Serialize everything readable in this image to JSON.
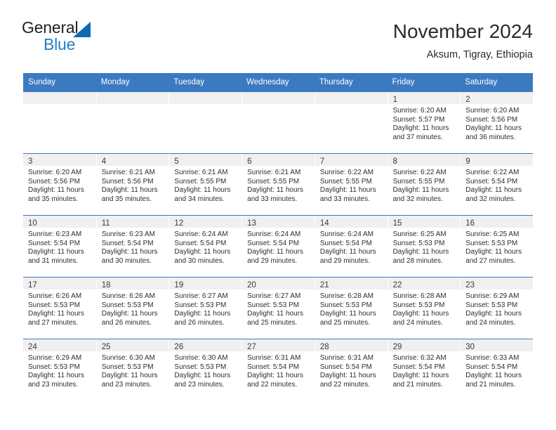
{
  "logo": {
    "text_primary": "General",
    "text_secondary": "Blue",
    "triangle_color": "#0b6cb1",
    "secondary_color": "#1f7fc4"
  },
  "header": {
    "month_title": "November 2024",
    "location": "Aksum, Tigray, Ethiopia",
    "accent_color": "#3b7ac0"
  },
  "weekdays": [
    "Sunday",
    "Monday",
    "Tuesday",
    "Wednesday",
    "Thursday",
    "Friday",
    "Saturday"
  ],
  "weeks": [
    [
      {
        "day": "",
        "sunrise": "",
        "sunset": "",
        "daylight_line1": "",
        "daylight_line2": "",
        "empty": true
      },
      {
        "day": "",
        "sunrise": "",
        "sunset": "",
        "daylight_line1": "",
        "daylight_line2": "",
        "empty": true
      },
      {
        "day": "",
        "sunrise": "",
        "sunset": "",
        "daylight_line1": "",
        "daylight_line2": "",
        "empty": true
      },
      {
        "day": "",
        "sunrise": "",
        "sunset": "",
        "daylight_line1": "",
        "daylight_line2": "",
        "empty": true
      },
      {
        "day": "",
        "sunrise": "",
        "sunset": "",
        "daylight_line1": "",
        "daylight_line2": "",
        "empty": true
      },
      {
        "day": "1",
        "sunrise": "Sunrise: 6:20 AM",
        "sunset": "Sunset: 5:57 PM",
        "daylight_line1": "Daylight: 11 hours",
        "daylight_line2": "and 37 minutes."
      },
      {
        "day": "2",
        "sunrise": "Sunrise: 6:20 AM",
        "sunset": "Sunset: 5:56 PM",
        "daylight_line1": "Daylight: 11 hours",
        "daylight_line2": "and 36 minutes."
      }
    ],
    [
      {
        "day": "3",
        "sunrise": "Sunrise: 6:20 AM",
        "sunset": "Sunset: 5:56 PM",
        "daylight_line1": "Daylight: 11 hours",
        "daylight_line2": "and 35 minutes."
      },
      {
        "day": "4",
        "sunrise": "Sunrise: 6:21 AM",
        "sunset": "Sunset: 5:56 PM",
        "daylight_line1": "Daylight: 11 hours",
        "daylight_line2": "and 35 minutes."
      },
      {
        "day": "5",
        "sunrise": "Sunrise: 6:21 AM",
        "sunset": "Sunset: 5:55 PM",
        "daylight_line1": "Daylight: 11 hours",
        "daylight_line2": "and 34 minutes."
      },
      {
        "day": "6",
        "sunrise": "Sunrise: 6:21 AM",
        "sunset": "Sunset: 5:55 PM",
        "daylight_line1": "Daylight: 11 hours",
        "daylight_line2": "and 33 minutes."
      },
      {
        "day": "7",
        "sunrise": "Sunrise: 6:22 AM",
        "sunset": "Sunset: 5:55 PM",
        "daylight_line1": "Daylight: 11 hours",
        "daylight_line2": "and 33 minutes."
      },
      {
        "day": "8",
        "sunrise": "Sunrise: 6:22 AM",
        "sunset": "Sunset: 5:55 PM",
        "daylight_line1": "Daylight: 11 hours",
        "daylight_line2": "and 32 minutes."
      },
      {
        "day": "9",
        "sunrise": "Sunrise: 6:22 AM",
        "sunset": "Sunset: 5:54 PM",
        "daylight_line1": "Daylight: 11 hours",
        "daylight_line2": "and 32 minutes."
      }
    ],
    [
      {
        "day": "10",
        "sunrise": "Sunrise: 6:23 AM",
        "sunset": "Sunset: 5:54 PM",
        "daylight_line1": "Daylight: 11 hours",
        "daylight_line2": "and 31 minutes."
      },
      {
        "day": "11",
        "sunrise": "Sunrise: 6:23 AM",
        "sunset": "Sunset: 5:54 PM",
        "daylight_line1": "Daylight: 11 hours",
        "daylight_line2": "and 30 minutes."
      },
      {
        "day": "12",
        "sunrise": "Sunrise: 6:24 AM",
        "sunset": "Sunset: 5:54 PM",
        "daylight_line1": "Daylight: 11 hours",
        "daylight_line2": "and 30 minutes."
      },
      {
        "day": "13",
        "sunrise": "Sunrise: 6:24 AM",
        "sunset": "Sunset: 5:54 PM",
        "daylight_line1": "Daylight: 11 hours",
        "daylight_line2": "and 29 minutes."
      },
      {
        "day": "14",
        "sunrise": "Sunrise: 6:24 AM",
        "sunset": "Sunset: 5:54 PM",
        "daylight_line1": "Daylight: 11 hours",
        "daylight_line2": "and 29 minutes."
      },
      {
        "day": "15",
        "sunrise": "Sunrise: 6:25 AM",
        "sunset": "Sunset: 5:53 PM",
        "daylight_line1": "Daylight: 11 hours",
        "daylight_line2": "and 28 minutes."
      },
      {
        "day": "16",
        "sunrise": "Sunrise: 6:25 AM",
        "sunset": "Sunset: 5:53 PM",
        "daylight_line1": "Daylight: 11 hours",
        "daylight_line2": "and 27 minutes."
      }
    ],
    [
      {
        "day": "17",
        "sunrise": "Sunrise: 6:26 AM",
        "sunset": "Sunset: 5:53 PM",
        "daylight_line1": "Daylight: 11 hours",
        "daylight_line2": "and 27 minutes."
      },
      {
        "day": "18",
        "sunrise": "Sunrise: 6:26 AM",
        "sunset": "Sunset: 5:53 PM",
        "daylight_line1": "Daylight: 11 hours",
        "daylight_line2": "and 26 minutes."
      },
      {
        "day": "19",
        "sunrise": "Sunrise: 6:27 AM",
        "sunset": "Sunset: 5:53 PM",
        "daylight_line1": "Daylight: 11 hours",
        "daylight_line2": "and 26 minutes."
      },
      {
        "day": "20",
        "sunrise": "Sunrise: 6:27 AM",
        "sunset": "Sunset: 5:53 PM",
        "daylight_line1": "Daylight: 11 hours",
        "daylight_line2": "and 25 minutes."
      },
      {
        "day": "21",
        "sunrise": "Sunrise: 6:28 AM",
        "sunset": "Sunset: 5:53 PM",
        "daylight_line1": "Daylight: 11 hours",
        "daylight_line2": "and 25 minutes."
      },
      {
        "day": "22",
        "sunrise": "Sunrise: 6:28 AM",
        "sunset": "Sunset: 5:53 PM",
        "daylight_line1": "Daylight: 11 hours",
        "daylight_line2": "and 24 minutes."
      },
      {
        "day": "23",
        "sunrise": "Sunrise: 6:29 AM",
        "sunset": "Sunset: 5:53 PM",
        "daylight_line1": "Daylight: 11 hours",
        "daylight_line2": "and 24 minutes."
      }
    ],
    [
      {
        "day": "24",
        "sunrise": "Sunrise: 6:29 AM",
        "sunset": "Sunset: 5:53 PM",
        "daylight_line1": "Daylight: 11 hours",
        "daylight_line2": "and 23 minutes."
      },
      {
        "day": "25",
        "sunrise": "Sunrise: 6:30 AM",
        "sunset": "Sunset: 5:53 PM",
        "daylight_line1": "Daylight: 11 hours",
        "daylight_line2": "and 23 minutes."
      },
      {
        "day": "26",
        "sunrise": "Sunrise: 6:30 AM",
        "sunset": "Sunset: 5:53 PM",
        "daylight_line1": "Daylight: 11 hours",
        "daylight_line2": "and 23 minutes."
      },
      {
        "day": "27",
        "sunrise": "Sunrise: 6:31 AM",
        "sunset": "Sunset: 5:54 PM",
        "daylight_line1": "Daylight: 11 hours",
        "daylight_line2": "and 22 minutes."
      },
      {
        "day": "28",
        "sunrise": "Sunrise: 6:31 AM",
        "sunset": "Sunset: 5:54 PM",
        "daylight_line1": "Daylight: 11 hours",
        "daylight_line2": "and 22 minutes."
      },
      {
        "day": "29",
        "sunrise": "Sunrise: 6:32 AM",
        "sunset": "Sunset: 5:54 PM",
        "daylight_line1": "Daylight: 11 hours",
        "daylight_line2": "and 21 minutes."
      },
      {
        "day": "30",
        "sunrise": "Sunrise: 6:33 AM",
        "sunset": "Sunset: 5:54 PM",
        "daylight_line1": "Daylight: 11 hours",
        "daylight_line2": "and 21 minutes."
      }
    ]
  ]
}
